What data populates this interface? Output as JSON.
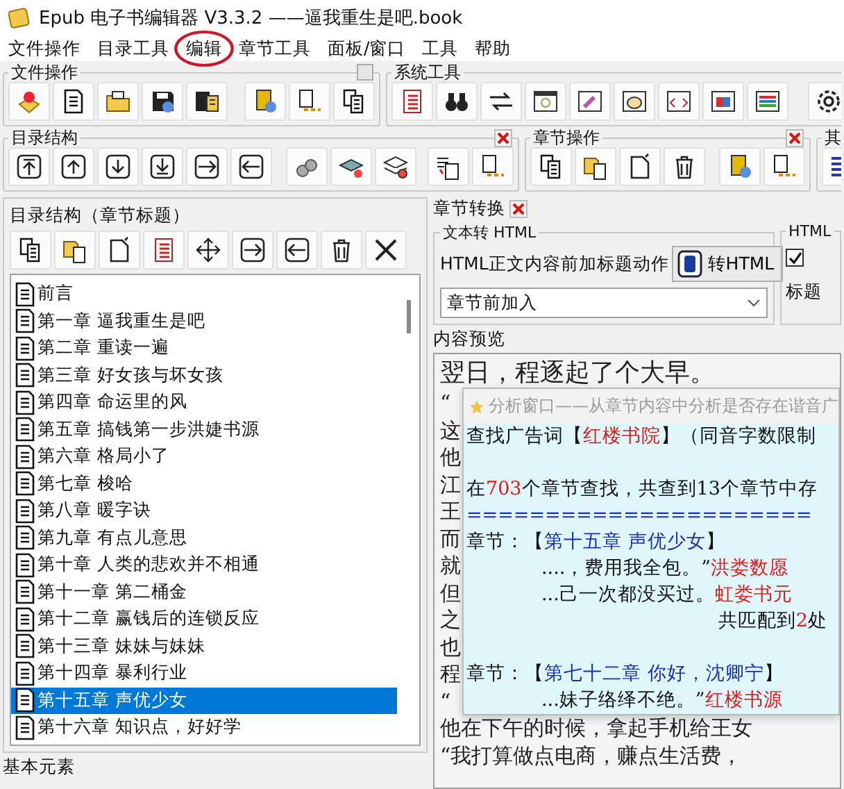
{
  "window": {
    "title": "Epub 电子书编辑器 V3.3.2 ——逼我重生是吧.book"
  },
  "menu": [
    {
      "label": "文件操作",
      "circled": false
    },
    {
      "label": "目录工具",
      "circled": false
    },
    {
      "label": "编辑",
      "circled": true
    },
    {
      "label": "章节工具",
      "circled": false
    },
    {
      "label": "面板/窗口",
      "circled": false
    },
    {
      "label": "工具",
      "circled": false
    },
    {
      "label": "帮助",
      "circled": false
    }
  ],
  "toolbars": {
    "file": {
      "title": "文件操作"
    },
    "system": {
      "title": "系统工具"
    },
    "toc": {
      "title": "目录结构"
    },
    "chapter": {
      "title": "章节操作"
    },
    "other": {
      "title": "其"
    }
  },
  "toc_panel": {
    "title": "目录结构（章节标题）",
    "items": [
      {
        "label": "前言",
        "selected": false
      },
      {
        "label": "第一章 逼我重生是吧",
        "selected": false
      },
      {
        "label": "第二章 重读一遍",
        "selected": false
      },
      {
        "label": "第三章 好女孩与坏女孩",
        "selected": false
      },
      {
        "label": "第四章 命运里的风",
        "selected": false
      },
      {
        "label": "第五章 搞钱第一步洪婕书源",
        "selected": false
      },
      {
        "label": "第六章 格局小了",
        "selected": false
      },
      {
        "label": "第七章 梭哈",
        "selected": false
      },
      {
        "label": "第八章 暖字诀",
        "selected": false
      },
      {
        "label": "第九章 有点儿意思",
        "selected": false
      },
      {
        "label": "第十章 人类的悲欢并不相通",
        "selected": false
      },
      {
        "label": "第十一章 第二桶金",
        "selected": false
      },
      {
        "label": "第十二章 赢钱后的连锁反应",
        "selected": false
      },
      {
        "label": "第十三章 妹妹与妹妹",
        "selected": false
      },
      {
        "label": "第十四章 暴利行业",
        "selected": false
      },
      {
        "label": "第十五章 声优少女",
        "selected": true
      },
      {
        "label": "第十六章 知识点，好好学",
        "selected": false
      }
    ]
  },
  "basic_elements": {
    "title": "基本元素"
  },
  "chapter_convert": {
    "title": "章节转换",
    "text_to_html": {
      "title": "文本转 HTML",
      "label": "HTML正文内容前加标题动作",
      "button": "转HTML",
      "select_value": "章节前加入"
    },
    "html_options": {
      "title": "HTML",
      "checkbox": {
        "checked": true
      },
      "label": "标题"
    }
  },
  "preview": {
    "title": "内容预览",
    "lines": [
      "翌日，程逐起了个大早。",
      "“",
      "这",
      "他",
      "江",
      "王",
      "而",
      "就",
      "但",
      "之",
      "也",
      "程",
      "“",
      "他在下午的时候，拿起手机给王女",
      "“我打算做点电商，赚点生活费，"
    ]
  },
  "analysis_window": {
    "title": "分析窗口——从章节内容中分析是否存在谐音广",
    "lines": [
      {
        "kind": "text",
        "segments": [
          {
            "text": "查找广告词【",
            "kind": "plain"
          },
          {
            "text": "红楼书院",
            "kind": "highlight"
          },
          {
            "text": "】（同音字数限制",
            "kind": "plain"
          }
        ]
      },
      {
        "kind": "blank"
      },
      {
        "kind": "text",
        "segments": [
          {
            "text": "在",
            "kind": "plain"
          },
          {
            "text": "703",
            "kind": "highlight"
          },
          {
            "text": "个章节查找，共查到13个章节中存",
            "kind": "plain"
          }
        ]
      },
      {
        "kind": "text",
        "segments": [
          {
            "text": "======================",
            "kind": "chapter"
          }
        ]
      },
      {
        "kind": "text",
        "segments": [
          {
            "text": "章节：【",
            "kind": "plain"
          },
          {
            "text": "第十五章 声优少女",
            "kind": "chapter"
          },
          {
            "text": "】",
            "kind": "plain"
          }
        ]
      },
      {
        "kind": "indented",
        "segments": [
          {
            "text": "....，费用我全包。”",
            "kind": "plain"
          },
          {
            "text": "洪娄数愿",
            "kind": "highlight"
          }
        ]
      },
      {
        "kind": "indented",
        "segments": [
          {
            "text": "...己一次都没买过。",
            "kind": "plain"
          },
          {
            "text": "虹娄书元",
            "kind": "highlight"
          }
        ]
      },
      {
        "kind": "summary",
        "segments": [
          {
            "text": "共匹配到",
            "kind": "plain"
          },
          {
            "text": "2",
            "kind": "highlight"
          },
          {
            "text": "处",
            "kind": "plain"
          }
        ]
      },
      {
        "kind": "blank"
      },
      {
        "kind": "text",
        "segments": [
          {
            "text": "章节：【",
            "kind": "plain"
          },
          {
            "text": "第七十二章 你好，沈卿宁",
            "kind": "chapter"
          },
          {
            "text": "】",
            "kind": "plain"
          }
        ]
      },
      {
        "kind": "indented",
        "segments": [
          {
            "text": "...妹子络绎不绝。”",
            "kind": "plain"
          },
          {
            "text": "红楼书源",
            "kind": "highlight"
          }
        ]
      }
    ]
  }
}
